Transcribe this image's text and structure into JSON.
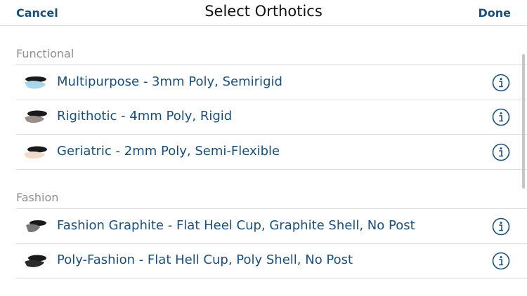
{
  "navbar": {
    "cancel_label": "Cancel",
    "title": "Select Orthotics",
    "done_label": "Done"
  },
  "sections": [
    {
      "header": "Functional",
      "items": [
        {
          "label": "Multipurpose - 3mm Poly, Semirigid",
          "icon": "orthotic-multipurpose-icon"
        },
        {
          "label": "Rigithotic - 4mm Poly, Rigid",
          "icon": "orthotic-rigithotic-icon"
        },
        {
          "label": "Geriatric - 2mm Poly, Semi-Flexible",
          "icon": "orthotic-geriatric-icon"
        }
      ]
    },
    {
      "header": "Fashion",
      "items": [
        {
          "label": "Fashion Graphite - Flat Heel Cup, Graphite Shell, No Post",
          "icon": "orthotic-fashion-graphite-icon"
        },
        {
          "label": "Poly-Fashion - Flat Hell Cup, Poly Shell, No Post",
          "icon": "orthotic-poly-fashion-icon"
        }
      ]
    }
  ],
  "colors": {
    "accent": "#1b4f78",
    "section_header": "#8e8e8e",
    "separator": "#dcdcdc"
  },
  "info_icon": "info-circle-icon"
}
